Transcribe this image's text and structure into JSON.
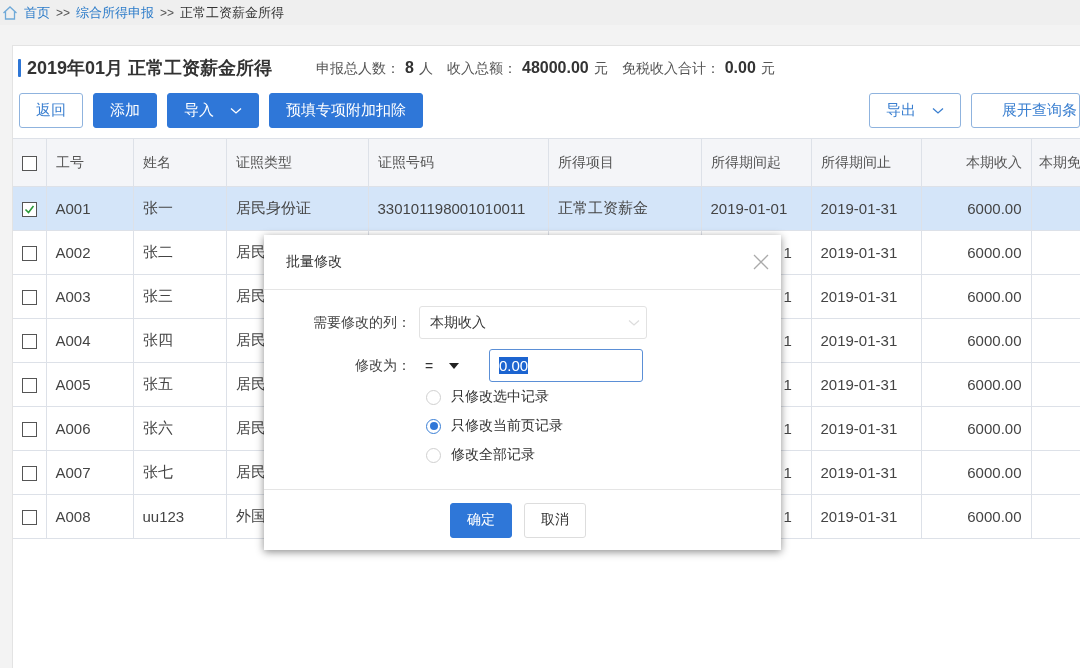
{
  "breadcrumb": [
    {
      "kind": "link",
      "label": "首页"
    },
    {
      "kind": "separator",
      "label": ">>"
    },
    {
      "kind": "link",
      "label": "综合所得申报"
    },
    {
      "kind": "separator",
      "label": ">>"
    },
    {
      "kind": "current",
      "label": "正常工资薪金所得"
    }
  ],
  "header": {
    "title": "2019年01月 正常工资薪金所得",
    "stats": [
      {
        "label": "申报总人数：",
        "value": "8",
        "unit": "人"
      },
      {
        "label": "收入总额：",
        "value": "48000.00",
        "unit": "元"
      },
      {
        "label": "免税收入合计：",
        "value": "0.00",
        "unit": "元"
      }
    ]
  },
  "toolbar": {
    "left": [
      {
        "label": "返回",
        "kind": "outline",
        "dropdown": false
      },
      {
        "label": "添加",
        "kind": "primary",
        "dropdown": false
      },
      {
        "label": "导入",
        "kind": "primary",
        "dropdown": true
      },
      {
        "label": "预填专项附加扣除",
        "kind": "primary",
        "dropdown": false
      }
    ],
    "right": [
      {
        "label": "导出",
        "kind": "outline",
        "dropdown": true
      },
      {
        "label": "展开查询条",
        "kind": "outline",
        "dropdown": false
      }
    ]
  },
  "table": {
    "select_all_checked": false,
    "columns": [
      {
        "label": "工号",
        "kind": "text"
      },
      {
        "label": "姓名",
        "kind": "text"
      },
      {
        "label": "证照类型",
        "kind": "text"
      },
      {
        "label": "证照号码",
        "kind": "text"
      },
      {
        "label": "所得项目",
        "kind": "text"
      },
      {
        "label": "所得期间起",
        "kind": "text"
      },
      {
        "label": "所得期间止",
        "kind": "text"
      },
      {
        "label": "本期收入",
        "kind": "amount"
      },
      {
        "label": "本期免",
        "kind": "text"
      }
    ],
    "rows": [
      {
        "checked": true,
        "selected": true,
        "cells": [
          "A001",
          "张一",
          "居民身份证",
          "330101198001010011",
          "正常工资薪金",
          "2019-01-01",
          "2019-01-31",
          "6000.00"
        ]
      },
      {
        "checked": false,
        "selected": false,
        "cells": [
          "A002",
          "张二",
          "居民",
          null,
          null,
          "1",
          "2019-01-31",
          "6000.00"
        ]
      },
      {
        "checked": false,
        "selected": false,
        "cells": [
          "A003",
          "张三",
          "居民",
          null,
          null,
          "1",
          "2019-01-31",
          "6000.00"
        ]
      },
      {
        "checked": false,
        "selected": false,
        "cells": [
          "A004",
          "张四",
          "居民",
          null,
          null,
          "1",
          "2019-01-31",
          "6000.00"
        ]
      },
      {
        "checked": false,
        "selected": false,
        "cells": [
          "A005",
          "张五",
          "居民",
          null,
          null,
          "1",
          "2019-01-31",
          "6000.00"
        ]
      },
      {
        "checked": false,
        "selected": false,
        "cells": [
          "A006",
          "张六",
          "居民",
          null,
          null,
          "1",
          "2019-01-31",
          "6000.00"
        ]
      },
      {
        "checked": false,
        "selected": false,
        "cells": [
          "A007",
          "张七",
          "居民",
          null,
          null,
          "1",
          "2019-01-31",
          "6000.00"
        ]
      },
      {
        "checked": false,
        "selected": false,
        "cells": [
          "A008",
          "uu123",
          "外国",
          null,
          null,
          "1",
          "2019-01-31",
          "6000.00"
        ]
      }
    ]
  },
  "dialog": {
    "title": "批量修改",
    "fields": [
      {
        "kind": "select",
        "label": "需要修改的列：",
        "value": "本期收入"
      },
      {
        "kind": "operator_input",
        "label": "修改为：",
        "operator": "=",
        "value": "0.00"
      }
    ],
    "scope_options": [
      {
        "label": "只修改选中记录",
        "selected": false
      },
      {
        "label": "只修改当前页记录",
        "selected": true
      },
      {
        "label": "修改全部记录",
        "selected": false
      }
    ],
    "buttons": [
      {
        "label": "确定",
        "kind": "primary"
      },
      {
        "label": "取消",
        "kind": "default"
      }
    ]
  }
}
